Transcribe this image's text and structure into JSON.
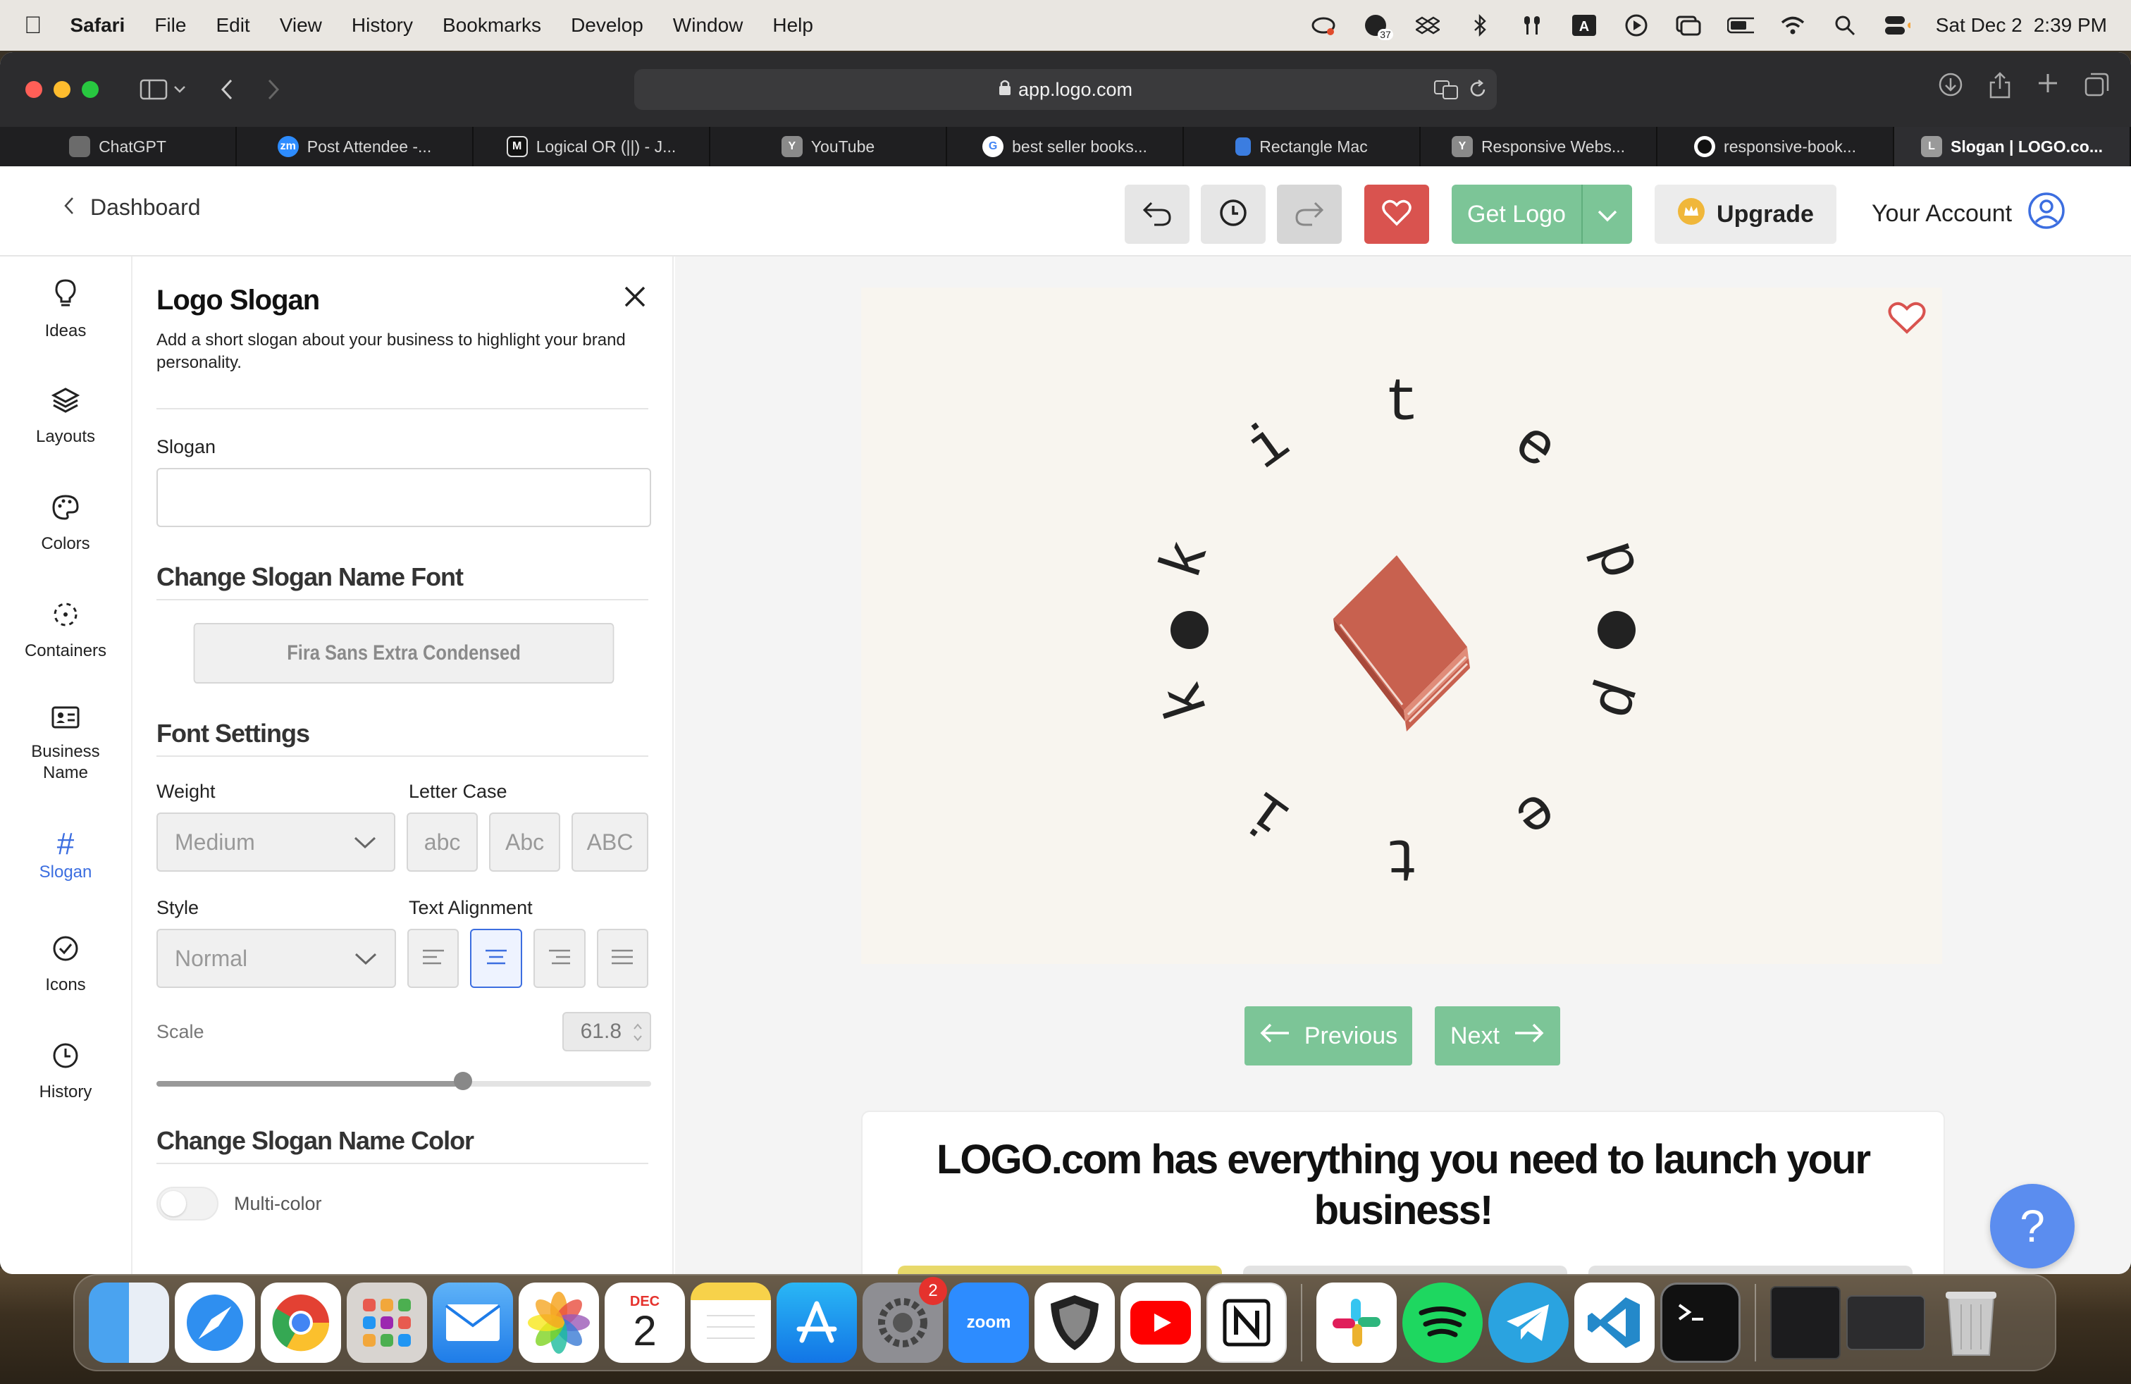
{
  "menubar": {
    "app": "Safari",
    "items": [
      "File",
      "Edit",
      "View",
      "History",
      "Bookmarks",
      "Develop",
      "Window",
      "Help"
    ],
    "date": "Sat Dec 2",
    "time": "2:39 PM",
    "badge_count": "37"
  },
  "browser": {
    "url": "app.logo.com",
    "tabs": [
      {
        "label": "ChatGPT",
        "icon": "chatgpt-icon",
        "color": "#6b6b6b",
        "glyph": ""
      },
      {
        "label": "Post Attendee -...",
        "icon": "zoom-icon",
        "color": "#2d8cff",
        "glyph": "zm"
      },
      {
        "label": "Logical OR (||) - J...",
        "icon": "mdn-icon",
        "color": "#111111",
        "glyph": "M"
      },
      {
        "label": "YouTube",
        "icon": "y-icon",
        "color": "#8a8a8a",
        "glyph": "Y"
      },
      {
        "label": "best seller books...",
        "icon": "google-icon",
        "color": "#ffffff",
        "glyph": "G"
      },
      {
        "label": "Rectangle Mac",
        "icon": "rectangle-icon",
        "color": "#3b7de0",
        "glyph": ""
      },
      {
        "label": "Responsive Webs...",
        "icon": "y-icon",
        "color": "#8a8a8a",
        "glyph": "Y"
      },
      {
        "label": "responsive-book...",
        "icon": "github-icon",
        "color": "#ffffff",
        "glyph": ""
      },
      {
        "label": "Slogan | LOGO.co...",
        "icon": "logo-com-icon",
        "color": "#9a9a9a",
        "glyph": "L"
      }
    ]
  },
  "header": {
    "back_label": "Dashboard",
    "get_logo": "Get Logo",
    "upgrade": "Upgrade",
    "account": "Your Account",
    "colors": {
      "accent": "#7cc597",
      "favorite": "#d9534f",
      "primary": "#3c6ee0"
    }
  },
  "sidenav": [
    {
      "label": "Ideas",
      "icon": "lightbulb-icon"
    },
    {
      "label": "Layouts",
      "icon": "layers-icon"
    },
    {
      "label": "Colors",
      "icon": "palette-icon"
    },
    {
      "label": "Containers",
      "icon": "container-icon"
    },
    {
      "label": "Business Name",
      "icon": "id-card-icon"
    },
    {
      "label": "Slogan",
      "icon": "hash-icon",
      "active": true
    },
    {
      "label": "Icons",
      "icon": "check-circle-icon"
    },
    {
      "label": "History",
      "icon": "clock-icon"
    }
  ],
  "panel": {
    "title": "Logo Slogan",
    "description": "Add a short slogan about your business to highlight your brand personality.",
    "slogan_label": "Slogan",
    "slogan_value": "",
    "font_section": "Change Slogan Name Font",
    "font_name": "Fira Sans Extra Condensed",
    "font_settings": "Font Settings",
    "weight_label": "Weight",
    "weight_value": "Medium",
    "letter_case_label": "Letter Case",
    "cases": [
      "abc",
      "Abc",
      "ABC"
    ],
    "style_label": "Style",
    "style_value": "Normal",
    "alignment_label": "Text Alignment",
    "alignment_selected": "center",
    "scale_label": "Scale",
    "scale_value": "61.8",
    "scale_fraction": 0.62,
    "color_section": "Change Slogan Name Color",
    "multicolor_label": "Multi-color"
  },
  "canvas": {
    "logo_letters": [
      "t",
      "e",
      "p",
      "p",
      "e",
      "t",
      "i",
      "k",
      "k",
      "i"
    ],
    "book_color": "#c8614f",
    "previous": "Previous",
    "next": "Next"
  },
  "promo": {
    "headline": "LOGO.com has everything you need to launch your business!"
  },
  "help_button": "?",
  "dock": {
    "calendar_month": "DEC",
    "calendar_day": "2",
    "settings_badge": "2",
    "zoom_label": "zoom"
  }
}
